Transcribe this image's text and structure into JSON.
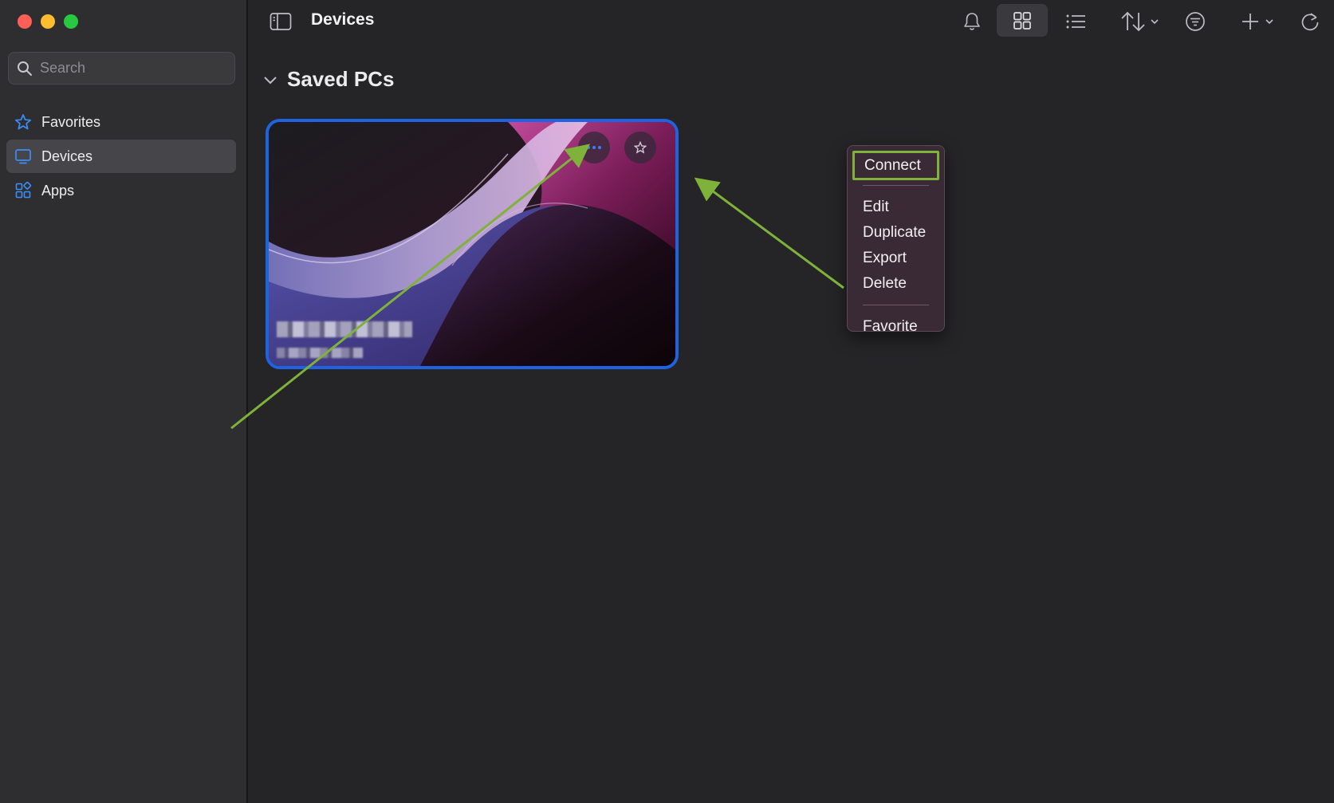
{
  "window": {
    "traffic_lights": [
      "close",
      "minimize",
      "zoom"
    ]
  },
  "sidebar": {
    "search_placeholder": "Search",
    "items": [
      {
        "label": "Favorites",
        "icon": "star-icon",
        "active": false
      },
      {
        "label": "Devices",
        "icon": "monitor-icon",
        "active": true
      },
      {
        "label": "Apps",
        "icon": "apps-icon",
        "active": false
      }
    ]
  },
  "toolbar": {
    "title": "Devices",
    "icons": [
      "sidebar-toggle-icon",
      "bell-icon",
      "grid-view-icon",
      "list-view-icon",
      "sort-icon",
      "filter-icon",
      "add-icon",
      "refresh-icon"
    ]
  },
  "main": {
    "section_title": "Saved PCs"
  },
  "context_menu": {
    "items": [
      "Connect",
      "Edit",
      "Duplicate",
      "Export",
      "Delete",
      "Favorite"
    ]
  },
  "colors": {
    "accent": "#1f63e0",
    "annotation": "#7fb23a",
    "sidebar_bg": "#2e2e31",
    "main_bg": "#252528"
  }
}
